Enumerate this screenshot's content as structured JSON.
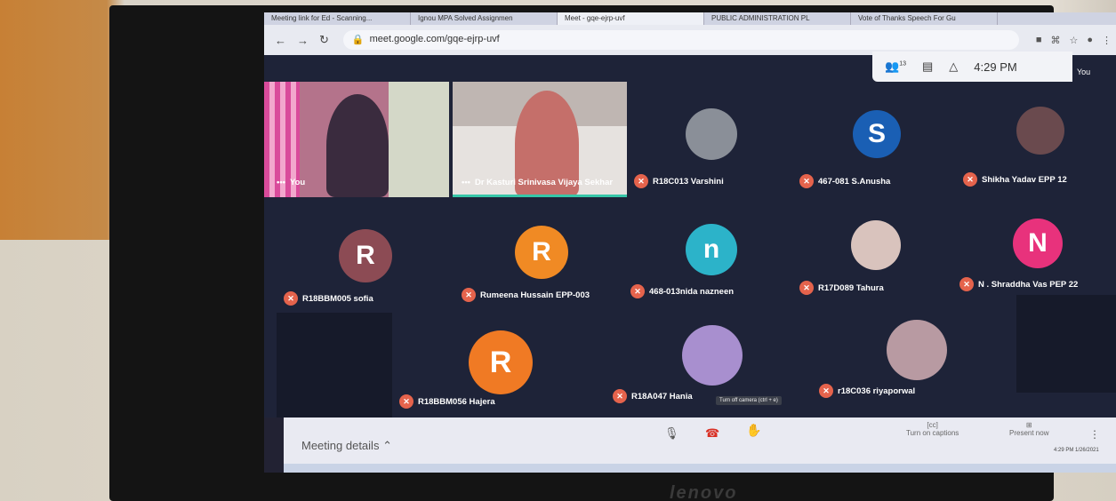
{
  "browser": {
    "tabs": [
      "Meeting link for Ed - Scanning...",
      "Ignou MPA Solved Assignmen",
      "Meet - gqe-ejrp-uvf",
      "PUBLIC ADMINISTRATION PL",
      "Vote of Thanks Speech For Gu"
    ],
    "url": "meet.google.com/gqe-ejrp-uvf"
  },
  "meet": {
    "participants_count": "13",
    "time": "4:29 PM",
    "you_corner": "You",
    "tiles": [
      {
        "name": "You",
        "video": true
      },
      {
        "name": "Dr Kasturi Srinivasa Vijaya Sekhar",
        "video": true
      },
      {
        "name": "R18C013 Varshini",
        "avatar": "photo",
        "color": "#8a8f98"
      },
      {
        "name": "467-081 S.Anusha",
        "avatar": "S",
        "color": "#1a5fb4"
      },
      {
        "name": "Shikha Yadav EPP 12",
        "avatar": "photo",
        "color": "#6a4a4e"
      },
      {
        "name": "R18BBM005 sofia",
        "avatar": "R",
        "color": "#8c4b54"
      },
      {
        "name": "Rumeena Hussain EPP-003",
        "avatar": "R",
        "color": "#f08a24"
      },
      {
        "name": "468-013nida nazneen",
        "avatar": "n",
        "color": "#2cb3c9"
      },
      {
        "name": "R17D089 Tahura",
        "avatar": "photo",
        "color": "#d9c3bd"
      },
      {
        "name": "N . Shraddha Vas PEP 22",
        "avatar": "N",
        "color": "#e8327c"
      },
      {
        "name": "R18BBM056 Hajera",
        "avatar": "R",
        "color": "#f07a24"
      },
      {
        "name": "R18A047 Hania",
        "avatar": "photo",
        "color": "#a88fcf"
      },
      {
        "name": "r18C036 riyaporwal",
        "avatar": "photo",
        "color": "#b89aa2"
      }
    ],
    "tooltip": "Turn off camera (ctrl + e)",
    "meeting_details": "Meeting details",
    "captions": "Turn on captions",
    "present": "Present now",
    "clock": "4:29 PM",
    "date": "1/26/2021"
  },
  "brand": "lenovo"
}
